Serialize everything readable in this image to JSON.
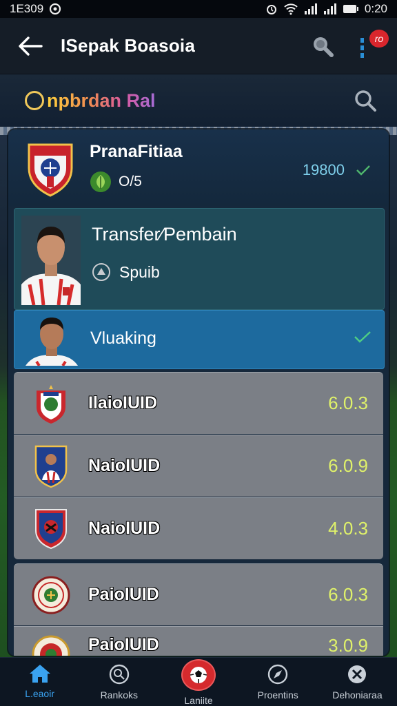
{
  "status_bar": {
    "left_text": "1E309",
    "time": "0:20"
  },
  "app_bar": {
    "title": "ISepak Boasoia",
    "notification_badge": "ro"
  },
  "sub_bar": {
    "brand": "npbrdan Ral"
  },
  "club": {
    "name": "PranaFitiaa",
    "sub_text": "O/5",
    "value": "19800"
  },
  "transfer": {
    "title": "Transfer⁄Pembain",
    "sub_text": "Spuib"
  },
  "selected_item": {
    "label": "Vluaking"
  },
  "rows": [
    {
      "name": "IlaioIUID",
      "value": "6.0.3"
    },
    {
      "name": "NaioIUID",
      "value": "6.0.9"
    },
    {
      "name": "NaioIUID",
      "value": "4.0.3"
    },
    {
      "name": "PaioIUID",
      "value": "6.0.3"
    },
    {
      "name": "PaioIUID",
      "value": "3.0.9"
    }
  ],
  "bottom_nav": [
    {
      "label": "L.eaoir",
      "icon": "home-icon",
      "active": true
    },
    {
      "label": "Rankoks",
      "icon": "ball-icon",
      "active": false
    },
    {
      "label": "Laniite",
      "icon": "football-icon",
      "active": false
    },
    {
      "label": "Proentins",
      "icon": "compass-icon",
      "active": false
    },
    {
      "label": "Dehoniaraa",
      "icon": "close-icon",
      "active": false
    }
  ],
  "colors": {
    "accent_blue": "#3aa2f0",
    "value_yellow": "#dff16a",
    "value_cyan": "#7fd0ec",
    "badge_red": "#d9262d",
    "selected_bg": "#1d6a9e"
  }
}
